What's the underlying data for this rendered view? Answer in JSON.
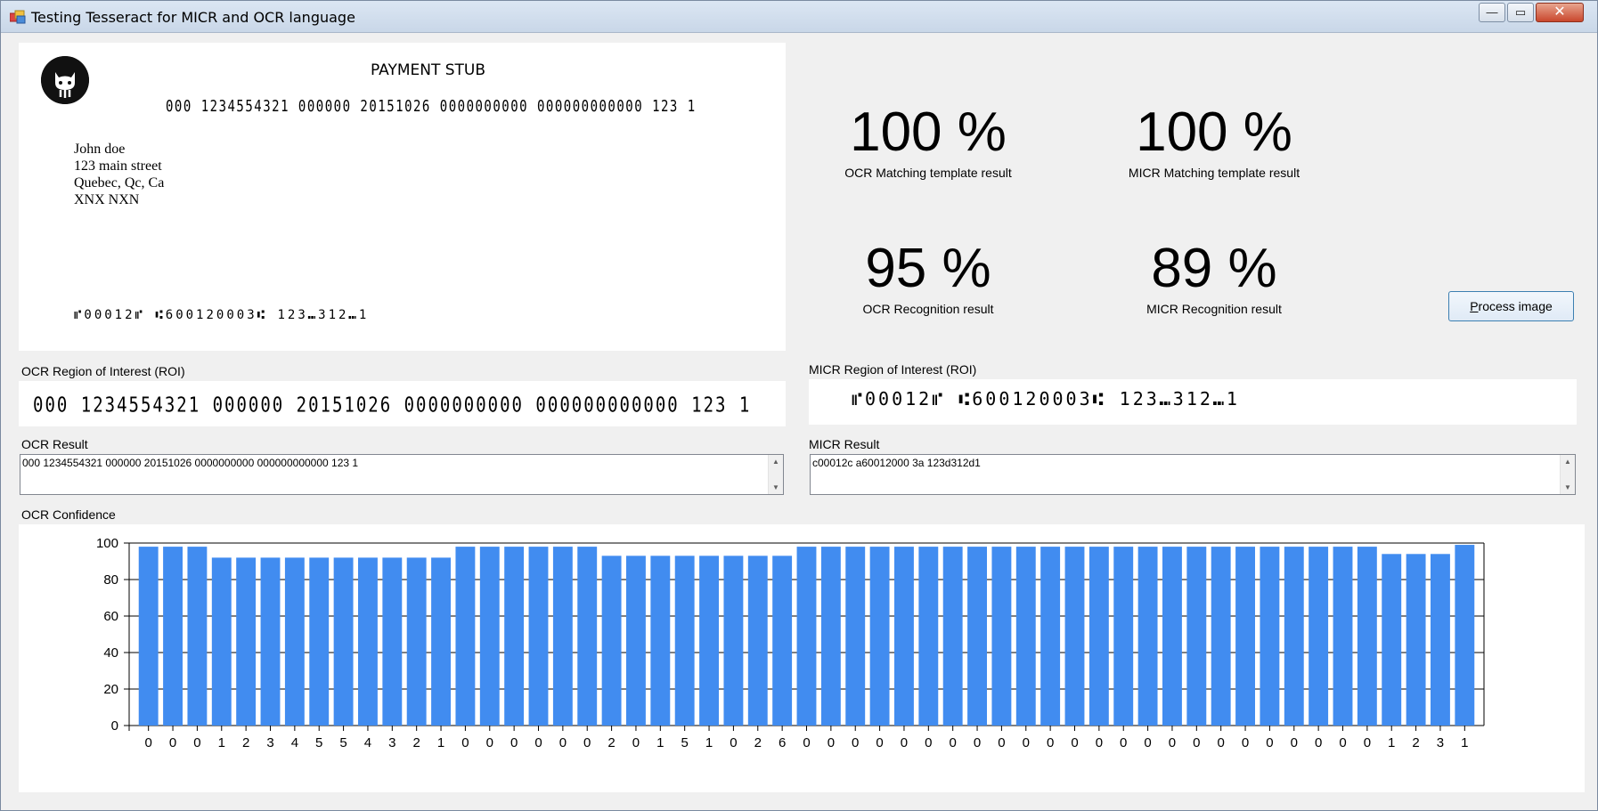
{
  "window": {
    "title": "Testing Tesseract for MICR and OCR language",
    "minimize": "—",
    "maximize": "▭",
    "close": "✕"
  },
  "stub": {
    "title": "PAYMENT STUB",
    "ocr_line": "000 1234554321 000000 20151026 0000000000 000000000000 123 1",
    "address": [
      "John doe",
      "123 main street",
      "Quebec, Qc, Ca",
      "XNX NXN"
    ],
    "micr_line": "⑈00012⑈ ⑆600120003⑆ 123⑉312⑉1"
  },
  "stats": {
    "ocr_template": {
      "value": "100 %",
      "label": "OCR Matching template result"
    },
    "micr_template": {
      "value": "100 %",
      "label": "MICR Matching template result"
    },
    "ocr_recognition": {
      "value": "95 %",
      "label": "OCR Recognition result"
    },
    "micr_recognition": {
      "value": "89 %",
      "label": "MICR Recognition result"
    }
  },
  "process_button": {
    "accel": "P",
    "rest": "rocess image"
  },
  "ocr_roi": {
    "label": "OCR Region of Interest (ROI)",
    "text": "000 1234554321 000000 20151026 0000000000 000000000000 123 1"
  },
  "micr_roi": {
    "label": "MICR Region of Interest (ROI)",
    "text": "⑈00012⑈ ⑆600120003⑆ 123⑉312⑉1"
  },
  "ocr_result": {
    "label": "OCR Result",
    "value": "000 1234554321 000000 20151026 0000000000 000000000000 123 1"
  },
  "micr_result": {
    "label": "MICR Result",
    "value": "c00012c a60012000 3a 123d312d1"
  },
  "confidence": {
    "label": "OCR Confidence"
  },
  "colors": {
    "bar": "#418cf0",
    "window_bg": "#f0f0f0"
  },
  "chart_data": {
    "type": "bar",
    "title": "",
    "xlabel": "",
    "ylabel": "",
    "ylim": [
      0,
      100
    ],
    "yticks": [
      0,
      20,
      40,
      60,
      80,
      100
    ],
    "categories": [
      "0",
      "0",
      "0",
      "1",
      "2",
      "3",
      "4",
      "5",
      "5",
      "4",
      "3",
      "2",
      "1",
      "0",
      "0",
      "0",
      "0",
      "0",
      "0",
      "2",
      "0",
      "1",
      "5",
      "1",
      "0",
      "2",
      "6",
      "0",
      "0",
      "0",
      "0",
      "0",
      "0",
      "0",
      "0",
      "0",
      "0",
      "0",
      "0",
      "0",
      "0",
      "0",
      "0",
      "0",
      "0",
      "0",
      "0",
      "0",
      "0",
      "0",
      "0",
      "1",
      "2",
      "3",
      "1"
    ],
    "values": [
      98,
      98,
      98,
      92,
      92,
      92,
      92,
      92,
      92,
      92,
      92,
      92,
      92,
      98,
      98,
      98,
      98,
      98,
      98,
      93,
      93,
      93,
      93,
      93,
      93,
      93,
      93,
      98,
      98,
      98,
      98,
      98,
      98,
      98,
      98,
      98,
      98,
      98,
      98,
      98,
      98,
      98,
      98,
      98,
      98,
      98,
      98,
      98,
      98,
      98,
      98,
      94,
      94,
      94,
      99
    ],
    "grid": true
  }
}
